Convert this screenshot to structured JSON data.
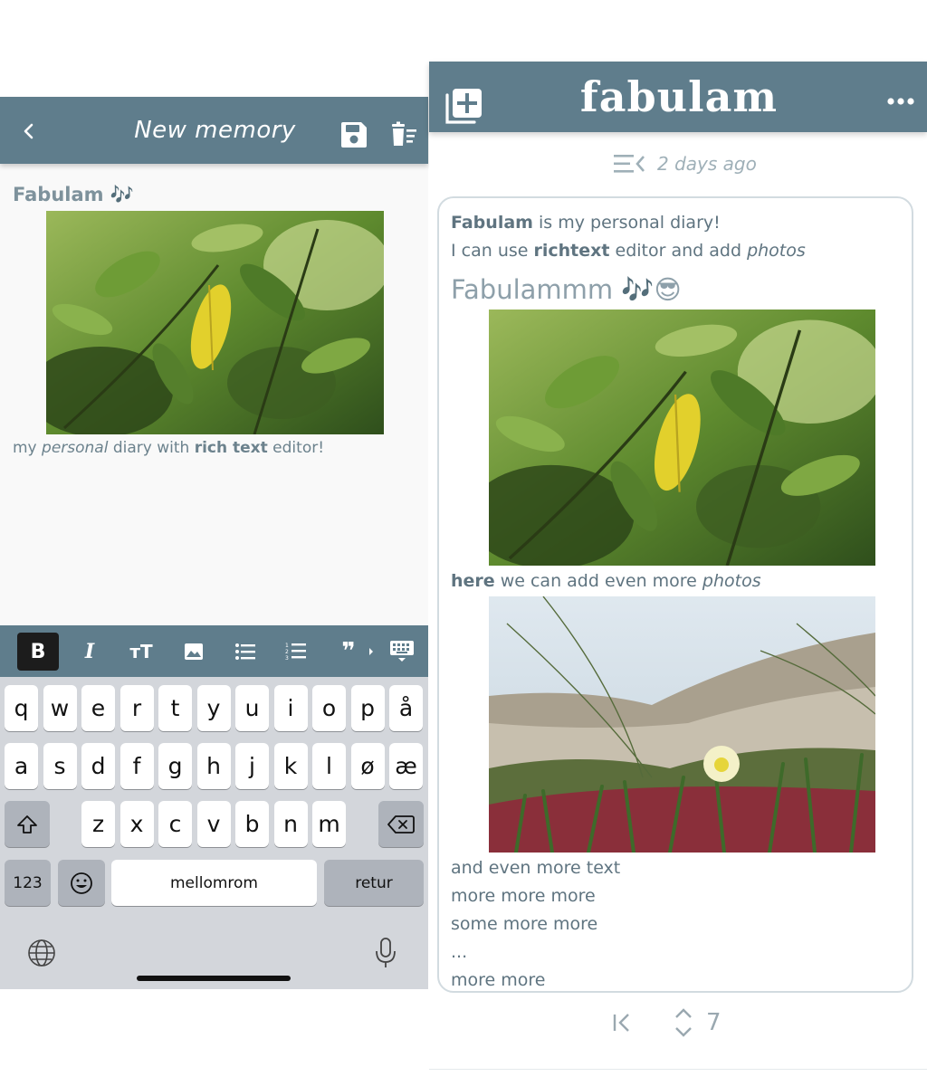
{
  "editor": {
    "title": "New memory",
    "heading": "Fabulam 🎶",
    "caption": {
      "part1": "my ",
      "italic": "personal",
      "part2": " diary with ",
      "bold": "rich text",
      "part3": " editor!"
    },
    "format_bar": {
      "bold_label": "B",
      "italic_label": "I",
      "size_label": "тT",
      "quote_label": "❞"
    }
  },
  "keyboard": {
    "row1": [
      "q",
      "w",
      "e",
      "r",
      "t",
      "y",
      "u",
      "i",
      "o",
      "p",
      "å"
    ],
    "row2": [
      "a",
      "s",
      "d",
      "f",
      "g",
      "h",
      "j",
      "k",
      "l",
      "ø",
      "æ"
    ],
    "row3": [
      "z",
      "x",
      "c",
      "v",
      "b",
      "n",
      "m"
    ],
    "numbers_label": "123",
    "emoji_label": "☺",
    "space_label": "mellomrom",
    "return_label": "retur"
  },
  "viewer": {
    "app_name": "fabulam",
    "date": "2 days ago",
    "lines": {
      "l1_bold": "Fabulam",
      "l1_rest": " is my personal diary!",
      "l2_a": "I can use ",
      "l2_bold": "richtext",
      "l2_b": " editor and add ",
      "l2_italic": "photos",
      "heading": "Fabulammm 🎶😎",
      "l3_bold": "here",
      "l3_rest": " we can add even more ",
      "l3_italic": "photos",
      "l4": "and even more text",
      "l5": "more more more",
      "l6": "some more more",
      "l7": "...",
      "l8": "more more"
    },
    "page_count": "7"
  },
  "colors": {
    "header": "#5f7d8c",
    "text": "#5f7480",
    "muted": "#9fb0b8"
  }
}
